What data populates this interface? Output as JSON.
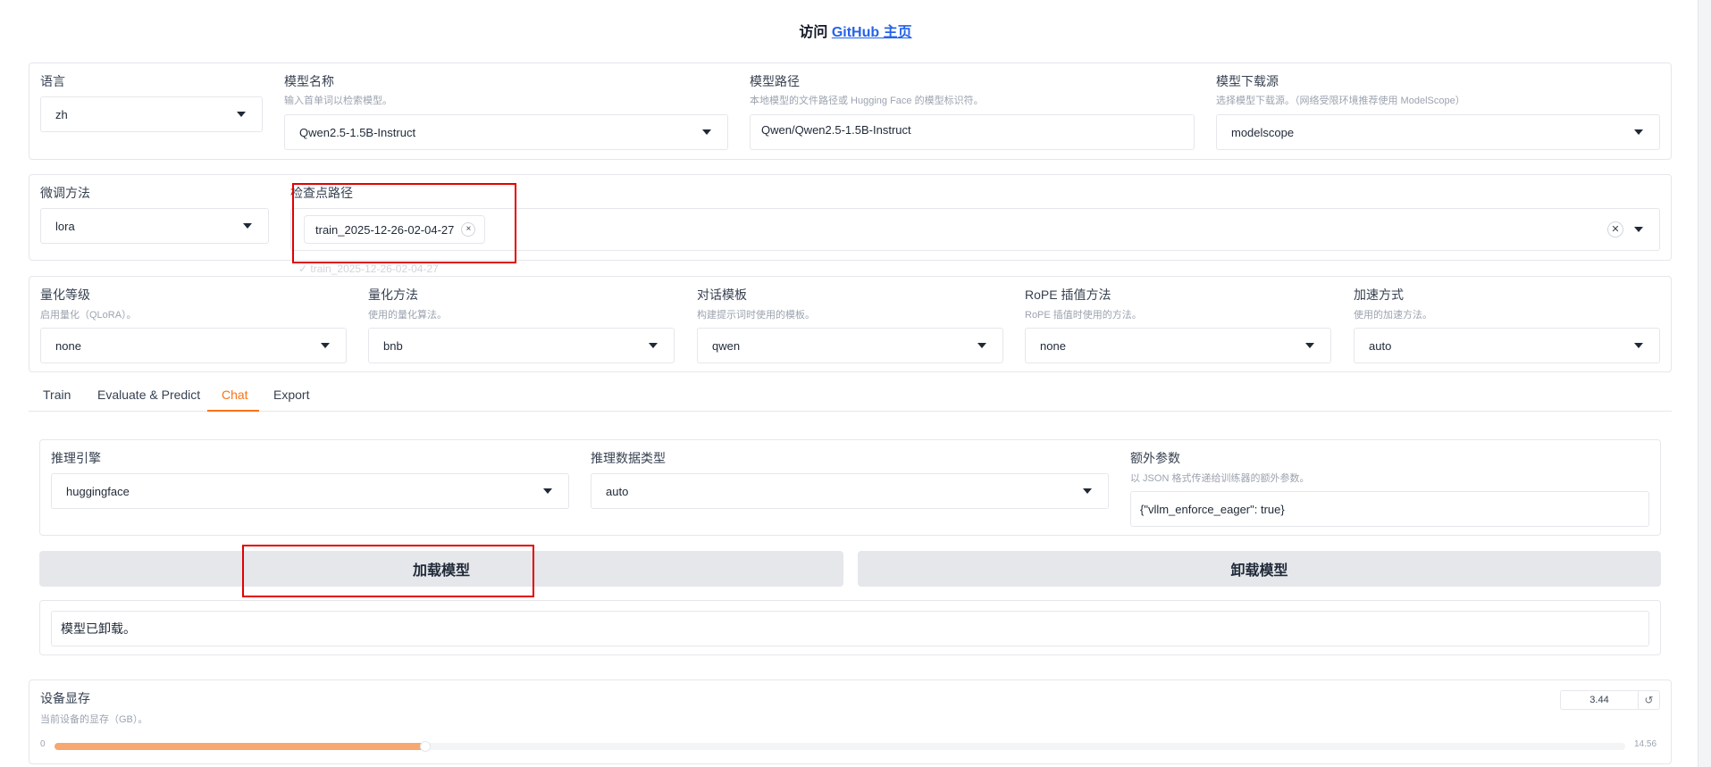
{
  "header": {
    "prefix": "访问 ",
    "link_text": "GitHub 主页"
  },
  "top": {
    "lang": {
      "label": "语言",
      "value": "zh"
    },
    "model_name": {
      "label": "模型名称",
      "info": "输入首单词以检索模型。",
      "value": "Qwen2.5-1.5B-Instruct"
    },
    "model_path": {
      "label": "模型路径",
      "info": "本地模型的文件路径或 Hugging Face 的模型标识符。",
      "value": "Qwen/Qwen2.5-1.5B-Instruct"
    },
    "hub": {
      "label": "模型下载源",
      "info": "选择模型下载源。（网络受限环境推荐使用 ModelScope）",
      "value": "modelscope"
    }
  },
  "finetune": {
    "method": {
      "label": "微调方法",
      "value": "lora"
    },
    "checkpoint": {
      "label": "检查点路径",
      "chip": "train_2025-12-26-02-04-27",
      "chip_close": "×",
      "clear": "✕",
      "dropdown_option": "✓ train_2025-12-26-02-04-27"
    }
  },
  "advanced": {
    "quant_bit": {
      "label": "量化等级",
      "info": "启用量化（QLoRA）。",
      "value": "none"
    },
    "quant_method": {
      "label": "量化方法",
      "info": "使用的量化算法。",
      "value": "bnb"
    },
    "template": {
      "label": "对话模板",
      "info": "构建提示词时使用的模板。",
      "value": "qwen"
    },
    "rope": {
      "label": "RoPE 插值方法",
      "info": "RoPE 插值时使用的方法。",
      "value": "none"
    },
    "booster": {
      "label": "加速方式",
      "info": "使用的加速方法。",
      "value": "auto"
    }
  },
  "tabs": [
    {
      "label": "Train",
      "active": false
    },
    {
      "label": "Evaluate & Predict",
      "active": false
    },
    {
      "label": "Chat",
      "active": true
    },
    {
      "label": "Export",
      "active": false
    }
  ],
  "chat": {
    "backend": {
      "label": "推理引擎",
      "value": "huggingface"
    },
    "dtype": {
      "label": "推理数据类型",
      "value": "auto"
    },
    "extra": {
      "label": "额外参数",
      "info": "以 JSON 格式传递给训练器的额外参数。",
      "value": "{\"vllm_enforce_eager\": true}"
    },
    "load_button": "加载模型",
    "unload_button": "卸载模型",
    "status": "模型已卸载。"
  },
  "memory": {
    "label": "设备显存",
    "info": "当前设备的显存（GB）。",
    "value": "3.44",
    "min": "0",
    "max": "14.56",
    "fraction": 0.2363,
    "reset_icon": "↺"
  },
  "colors": {
    "accent": "#f97316",
    "link": "#2563eb",
    "slider_fill": "#f6a870",
    "annotation": "#e30000"
  }
}
